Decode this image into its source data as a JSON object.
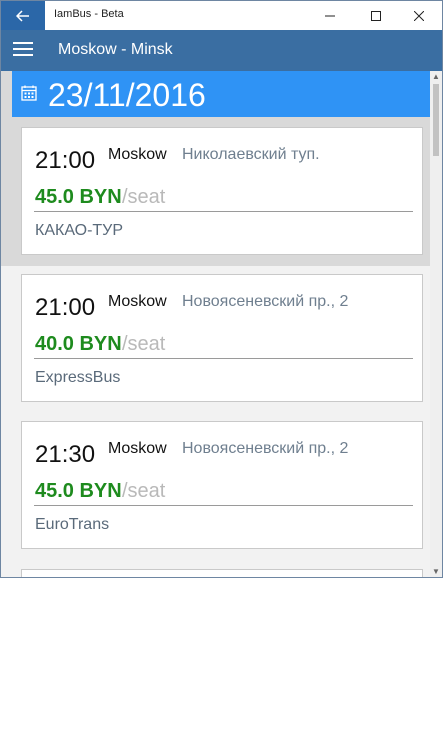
{
  "window": {
    "app_title": "IamBus - Beta",
    "back_icon": "arrow-left-icon",
    "minimize_icon": "minimize-icon",
    "maximize_icon": "maximize-icon",
    "close_icon": "close-icon"
  },
  "header": {
    "menu_icon": "hamburger-icon",
    "route_title": "Moskow - Minsk"
  },
  "date": {
    "icon": "calendar-icon",
    "label": "23/11/2016"
  },
  "trips": [
    {
      "time": "21:00",
      "city": "Moskow",
      "stop": "Николаевский туп.",
      "price": "45.0 BYN",
      "per_seat": "/seat",
      "company": "КАКАО-ТУР"
    },
    {
      "time": "21:00",
      "city": "Moskow",
      "stop": "Новоясеневский пр., 2",
      "price": "40.0 BYN",
      "per_seat": "/seat",
      "company": "ExpressBus"
    },
    {
      "time": "21:30",
      "city": "Moskow",
      "stop": "Новоясеневский пр., 2",
      "price": "45.0 BYN",
      "per_seat": "/seat",
      "company": "EuroTrans"
    }
  ],
  "colors": {
    "accent": "#2b67a8",
    "header": "#3a6ea2",
    "date_bar": "#2f93f5",
    "price": "#1e8b1e"
  }
}
